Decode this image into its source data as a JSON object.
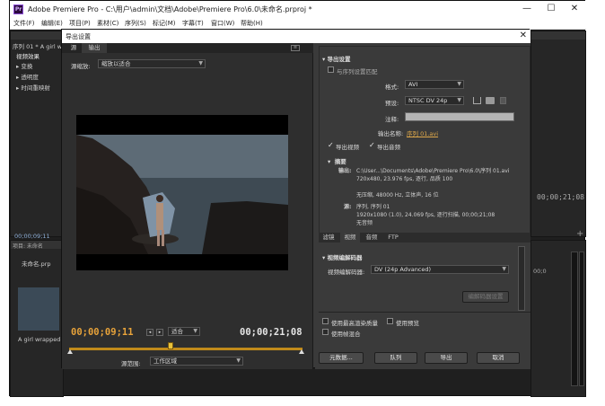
{
  "window": {
    "title": "Adobe Premiere Pro - C:\\用户\\admin\\文档\\Adobe\\Premiere Pro\\6.0\\未命名.prproj *",
    "logo": "Pr",
    "controls": {
      "min": "—",
      "max": "☐",
      "close": "✕"
    }
  },
  "menu": [
    "文件(F)",
    "编辑(E)",
    "项目(P)",
    "素材(C)",
    "序列(S)",
    "标记(M)",
    "字幕(T)",
    "窗口(W)",
    "帮助(H)"
  ],
  "background": {
    "panel_title": "序列 01 * A girl w",
    "effects_label": "视频效果",
    "tree": [
      "▸ 变换",
      "▸ 透明度",
      "▸ 时间重映射"
    ],
    "left_tc": "00;00;09;11",
    "project_tab": "项目: 未命名",
    "project_file": "未命名.prp",
    "clip_name": "A girl wrapped h",
    "right_tc": "00;00;21;08",
    "right_tc2": "00;0",
    "plus": "+"
  },
  "dialog": {
    "title": "导出设置",
    "close": "✕",
    "left": {
      "tabs": [
        "源",
        "输出"
      ],
      "scale_label": "源缩放:",
      "scale_value": "缩放以适合",
      "tc_current": "00;00;09;11",
      "tc_end": "00;00;21;08",
      "fit_value": "适合",
      "range_label": "源范围:",
      "range_value": "工作区域"
    },
    "right": {
      "section_title": "导出设置",
      "match_sequence": "与序列设置匹配",
      "format_label": "格式:",
      "format_value": "AVI",
      "preset_label": "预设:",
      "preset_value": "NTSC DV 24p",
      "comment_label": "注释:",
      "output_name_label": "输出名称:",
      "output_name_value": "序列 01.avi",
      "export_video": "导出视频",
      "export_audio": "导出音频",
      "summary_title": "摘要",
      "output_label": "输出:",
      "output_lines": [
        "C:\\User...\\Documents\\Adobe\\Premiere Pro\\6.0\\序列 01.avi",
        "720x480, 23.976 fps, 逐行, 品质 100",
        "",
        "无压缩, 48000 Hz, 立体声, 16 位"
      ],
      "source_label": "源:",
      "source_lines": [
        "序列, 序列 01",
        "1920x1080 (1.0), 24.069 fps, 逐行扫描, 00;00;21;08",
        "无音频"
      ],
      "tabs": [
        "滤镜",
        "视频",
        "音频",
        "FTP"
      ],
      "active_tab": "视频",
      "codec_section": "视频编解码器",
      "codec_label": "视频编解码器:",
      "codec_value": "DV (24p Advanced)",
      "codec_settings": "编解码器设置",
      "max_quality": "使用最高渲染质量",
      "use_preview": "使用预览",
      "frame_blend": "使用帧混合",
      "buttons": {
        "metadata": "元数据...",
        "queue": "队列",
        "export": "导出",
        "cancel": "取消"
      }
    }
  },
  "colors": {
    "accent": "#e8a33a",
    "timeline_bar": "#c08a1a",
    "link": "#e0a94a",
    "panel": "#3a3a3a"
  }
}
